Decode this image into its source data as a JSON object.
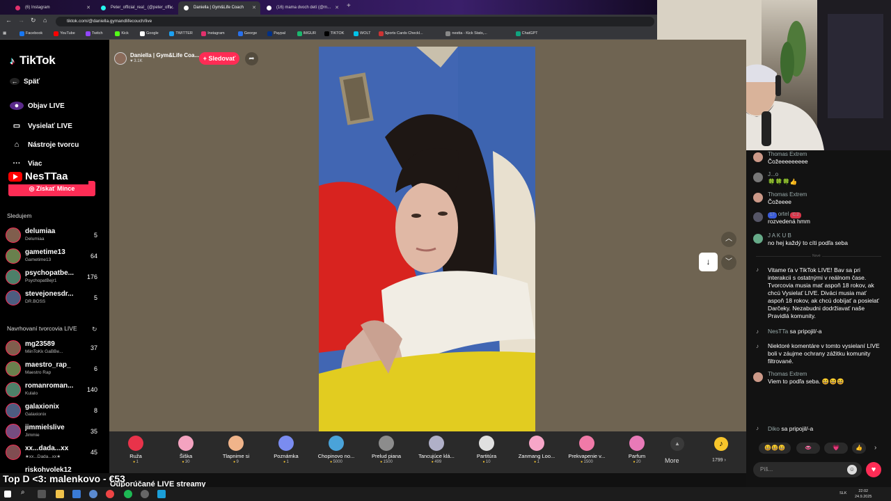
{
  "browser": {
    "tabs": [
      {
        "label": "(6) Instagram",
        "color": "#e1306c"
      },
      {
        "label": "Peter_official_real_ (@peter_offi...",
        "color": "#25f4ee"
      },
      {
        "label": "Daniella | Gym&Life Coach",
        "color": "#ffffff"
      },
      {
        "label": "(16) mama dvoch detí (@m...",
        "color": "#ffffff"
      }
    ],
    "new_tab": "+",
    "url": "tiktok.com/@daniella.gymandlifecouch/live",
    "bookmarks": [
      {
        "label": "Facebook",
        "color": "#1877f2"
      },
      {
        "label": "YouTube",
        "color": "#ff0000"
      },
      {
        "label": "Twitch",
        "color": "#9146ff"
      },
      {
        "label": "Kick",
        "color": "#53fc18"
      },
      {
        "label": "Google",
        "color": "#ffffff"
      },
      {
        "label": "TWITTER",
        "color": "#1da1f2"
      },
      {
        "label": "Instagram",
        "color": "#e1306c"
      },
      {
        "label": "George",
        "color": "#2870ed"
      },
      {
        "label": "Paypal",
        "color": "#003087"
      },
      {
        "label": "IMGUR",
        "color": "#1bb76e"
      },
      {
        "label": "TIKTOK",
        "color": "#000000"
      },
      {
        "label": "WOLT",
        "color": "#00c2e8"
      },
      {
        "label": "Sports Cards Checkl...",
        "color": "#cc3333"
      },
      {
        "label": "nestta - Kick Stats,...",
        "color": "#888888"
      },
      {
        "label": "ChatGPT",
        "color": "#10a37f"
      }
    ]
  },
  "sidebar": {
    "logo": "TikTok",
    "back": "Späť",
    "links": [
      "Objav LIVE",
      "Vysielať LIVE",
      "Nástroje tvorcu",
      "Viac"
    ],
    "overlay_name": "NesTTaa",
    "coins_button": "Získať Mince",
    "following_title": "Sledujem",
    "following": [
      {
        "name": "delumiaa",
        "sub": "Delumiaa",
        "count": "5"
      },
      {
        "name": "gametime13",
        "sub": "Gametime13",
        "count": "64"
      },
      {
        "name": "psychopatbe...",
        "sub": "PsychopatBejr1",
        "count": "176"
      },
      {
        "name": "stevejonesdr...",
        "sub": "DR.BOSS",
        "count": "5"
      }
    ],
    "suggested_title": "Navrhovaní tvorcovia LIVE",
    "suggested": [
      {
        "name": "mg23589",
        "sub": "MiinToKk GaBBe...",
        "count": "37"
      },
      {
        "name": "maestro_rap_",
        "sub": "Maestro Rap",
        "count": "6"
      },
      {
        "name": "romanroman...",
        "sub": "Kulalo",
        "count": "140"
      },
      {
        "name": "galaxionix",
        "sub": "Galaxionix",
        "count": "8"
      },
      {
        "name": "jimmielslive",
        "sub": "Jimmie",
        "count": "35"
      },
      {
        "name": "xx...dada...xx",
        "sub": "★xx...Dada...xx★",
        "count": "45"
      },
      {
        "name": "riskohvolek12",
        "sub": "",
        "count": ""
      }
    ]
  },
  "stream": {
    "host_name": "Daniella | Gym&Life Coa...",
    "host_likes": "3.1K",
    "follow_label": "+ Sledovať"
  },
  "gifts": [
    {
      "name": "Ruža",
      "price": "1",
      "color": "#e8334a"
    },
    {
      "name": "Šiška",
      "price": "30",
      "color": "#f4a3c0"
    },
    {
      "name": "Tlapnime si",
      "price": "9",
      "color": "#f0b48a"
    },
    {
      "name": "Poznámka",
      "price": "1",
      "color": "#7a8cf0"
    },
    {
      "name": "Chopinovo no...",
      "price": "5000",
      "color": "#4aa3d9"
    },
    {
      "name": "Prelud piana",
      "price": "1500",
      "color": "#8c8c8c"
    },
    {
      "name": "Tancujúce klá...",
      "price": "499",
      "color": "#b0b0c8"
    },
    {
      "name": "Partitúra",
      "price": "10",
      "color": "#e0e0e0"
    },
    {
      "name": "Zanmang Loo...",
      "price": "1",
      "color": "#f7a6c8"
    },
    {
      "name": "Prekvapenie v...",
      "price": "1500",
      "color": "#f07aa8"
    },
    {
      "name": "Parfum",
      "price": "20",
      "color": "#e87ab8"
    }
  ],
  "gift_more": "More",
  "coin_balance": "1799 ›",
  "bottom_overlay": "Top D <3: malenkovo - €53",
  "recommended_title": "Odporúčané LIVE streamy",
  "chat": {
    "messages": [
      {
        "user": "Thomas Extrem",
        "text": "Čožeeeeeeeee"
      },
      {
        "user": "J...o",
        "text": "🍀🍀🍀👍"
      },
      {
        "user": "Thomas Extrem",
        "text": "Čožeeee"
      },
      {
        "user": "ortel",
        "badge1": "17",
        "badge2": "C.2",
        "text": "rozvedená hmm"
      },
      {
        "user": "J A K U B",
        "text": "no hej každý to cíti podľa seba"
      }
    ],
    "divider": "Nové",
    "welcome": "Vitame ťa v TikTok LIVE! Bav sa pri interakcii s ostatnými v reálnom čase. Tvorcovia musia mať aspoň 18 rokov, ak chcú Vysielať LIVE. Diváci musia mať aspoň 18 rokov, ak chcú dobíjať a posielať Darčeky. Nezabudni dodržiavať naše Pravidlá komunity.",
    "join1_user": "NesTTa",
    "join1_text": "sa pripojil/-a",
    "moderation": "Niektoré komentáre v tomto vysielaní LIVE boli v záujme ochrany zážitku komunity filtrované.",
    "last": {
      "user": "Thomas Extrem",
      "text": "Viem to podľa seba. 😆😆😆"
    },
    "join2_user": "Diko",
    "join2_text": "sa pripojil/-a",
    "quick_emojis": [
      "😆😆😆",
      "👄",
      "💗",
      "👍"
    ],
    "input_placeholder": "Píš..."
  },
  "taskbar": {
    "lang": "SLK",
    "time": "22:02",
    "date": "24.9.2025"
  }
}
